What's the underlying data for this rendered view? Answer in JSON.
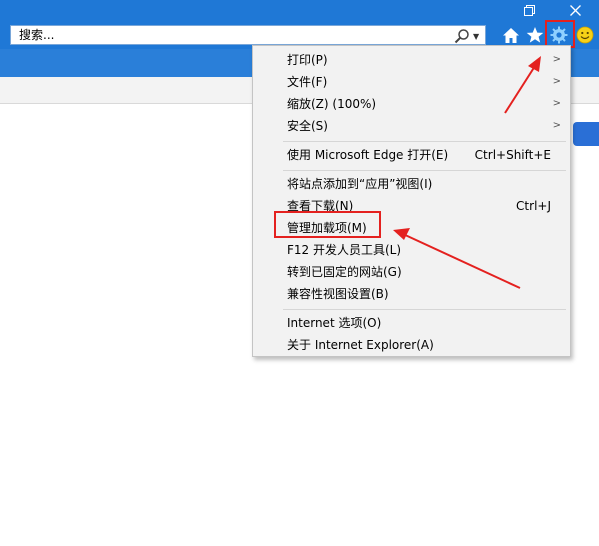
{
  "window": {
    "restore_icon": "restore-icon",
    "close_icon": "close-icon"
  },
  "address": {
    "placeholder": "搜索..."
  },
  "toolbar": {
    "icons": [
      "home-icon",
      "star-icon",
      "gear-icon",
      "smiley-icon"
    ]
  },
  "menu": {
    "print": "打印(P)",
    "file": "文件(F)",
    "zoom": "缩放(Z) (100%)",
    "safety": "安全(S)",
    "open_edge": "使用 Microsoft Edge 打开(E)",
    "open_edge_shortcut": "Ctrl+Shift+E",
    "add_to_apps": "将站点添加到“应用”视图(I)",
    "downloads": "查看下载(N)",
    "downloads_shortcut": "Ctrl+J",
    "manage_addons": "管理加载项(M)",
    "f12_tools": "F12 开发人员工具(L)",
    "pinned_sites": "转到已固定的网站(G)",
    "compat_view": "兼容性视图设置(B)",
    "internet_options": "Internet 选项(O)",
    "about_ie": "关于 Internet Explorer(A)"
  },
  "colors": {
    "accent": "#1f78d6",
    "annotation_red": "#e4211f",
    "menu_bg": "#f2f2f2"
  }
}
